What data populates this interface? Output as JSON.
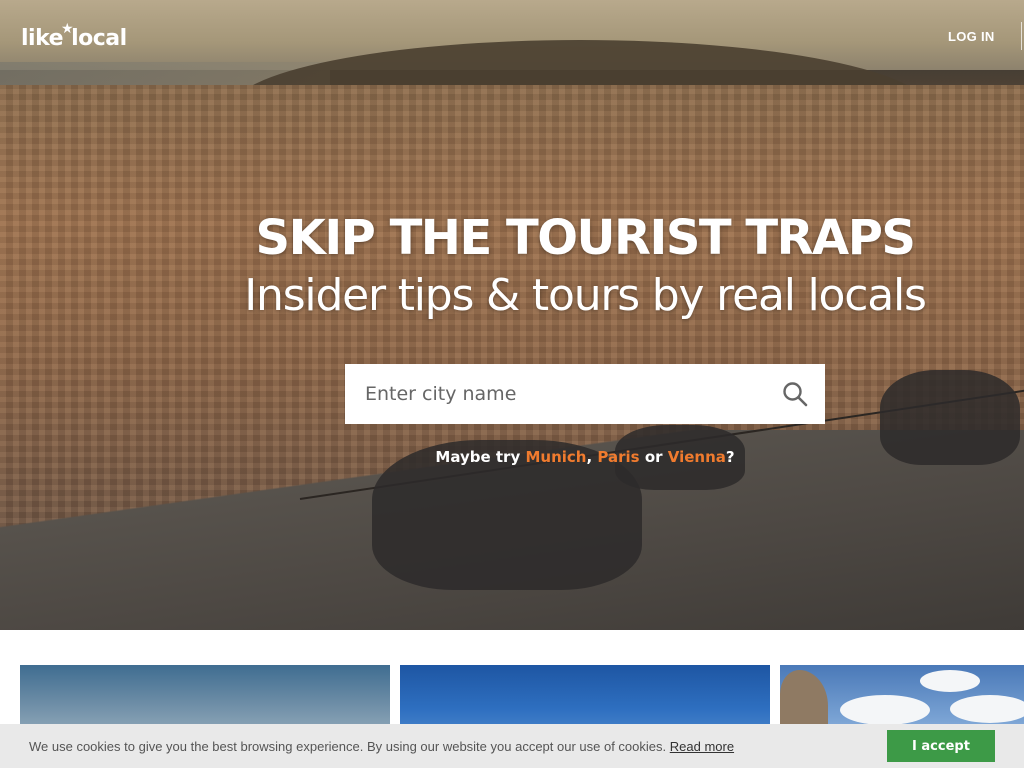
{
  "header": {
    "logo_left": "like",
    "logo_right": "local",
    "login_label": "LOG IN"
  },
  "hero": {
    "title": "SKIP THE TOURIST TRAPS",
    "subtitle": "Insider tips & tours by real locals",
    "search": {
      "placeholder": "Enter city name",
      "value": ""
    },
    "suggest": {
      "prefix": "Maybe try",
      "cities": [
        "Munich",
        "Paris",
        "Vienna"
      ],
      "sep1": ",",
      "sep2": "or",
      "suffix": "?"
    }
  },
  "cookie": {
    "text": "We use cookies to give you the best browsing experience. By using our website you accept our use of cookies.",
    "link_label": "Read more",
    "accept_label": "I accept"
  },
  "colors": {
    "accent_orange": "#f07b2e",
    "accept_green": "#3d9a47",
    "cookie_bg": "#e9e9e9"
  },
  "icons": {
    "search": "search-icon",
    "logo_star": "star-person-icon"
  }
}
